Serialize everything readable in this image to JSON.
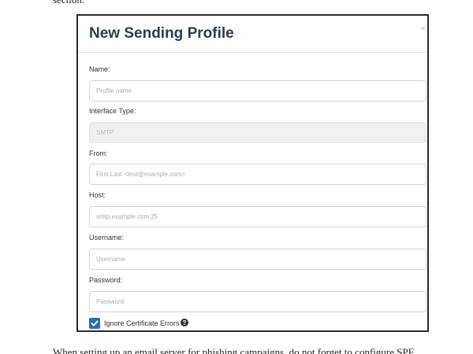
{
  "book": {
    "top_text": "section.",
    "bottom_text": "When setting up an email server for phishing campaigns, do not forget to configure SPF"
  },
  "modal": {
    "title": "New Sending Profile",
    "close_symbol": "×",
    "fields": {
      "name": {
        "label": "Name:",
        "placeholder": "Profile name",
        "value": ""
      },
      "interface_type": {
        "label": "Interface Type:",
        "value": "SMTP",
        "readonly": true
      },
      "from": {
        "label": "From:",
        "placeholder": "First Last <test@example.com>",
        "value": ""
      },
      "host": {
        "label": "Host:",
        "placeholder": "smtp.example.com:25",
        "value": ""
      },
      "username": {
        "label": "Username:",
        "placeholder": "Username",
        "value": ""
      },
      "password": {
        "label": "Password:",
        "placeholder": "Password",
        "value": ""
      }
    },
    "ignore_cert_errors": {
      "label": "Ignore Certificate Errors",
      "checked": true,
      "icon": "question-circle-icon"
    }
  },
  "colors": {
    "title": "#283f50",
    "checkbox": "#2a6fb0",
    "readonly_bg": "#eef0f2",
    "input_border": "#d2d6da"
  }
}
